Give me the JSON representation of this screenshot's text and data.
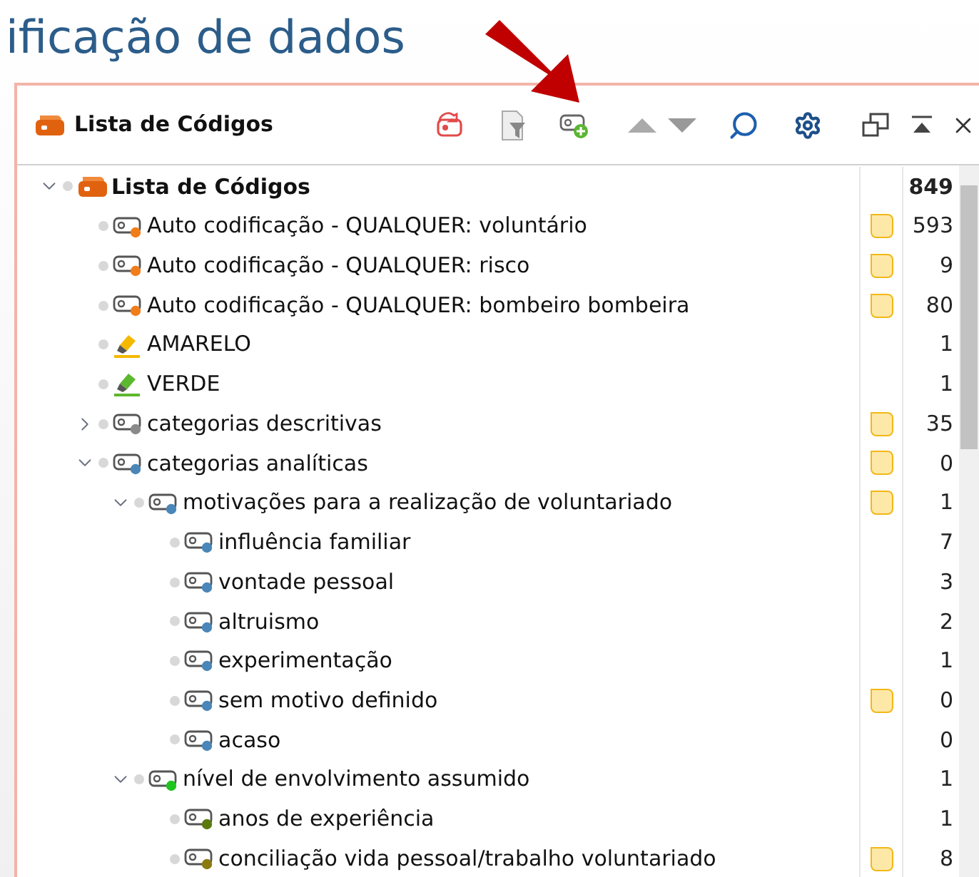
{
  "heading": "ificação de dados",
  "panel": {
    "title": "Lista de Códigos"
  },
  "tree": [
    {
      "label": "Lista de Códigos",
      "kind": "root",
      "expanded": true,
      "memo": false,
      "count": "849",
      "children": [
        {
          "label": "Auto codificação - QUALQUER: voluntário",
          "kind": "code",
          "color": "#f07d1a",
          "memo": true,
          "count": "593"
        },
        {
          "label": "Auto codificação - QUALQUER: risco",
          "kind": "code",
          "color": "#f07d1a",
          "memo": true,
          "count": "9"
        },
        {
          "label": "Auto codificação - QUALQUER: bombeiro bombeira",
          "kind": "code",
          "color": "#f07d1a",
          "memo": true,
          "count": "80"
        },
        {
          "label": "AMARELO",
          "kind": "highlight",
          "color": "#f5b800",
          "memo": false,
          "count": "1"
        },
        {
          "label": "VERDE",
          "kind": "highlight",
          "color": "#5cb82e",
          "memo": false,
          "count": "1"
        },
        {
          "label": "categorias descritivas",
          "kind": "code",
          "color": "#8a8a8a",
          "expanded": false,
          "memo": true,
          "count": "35"
        },
        {
          "label": "categorias analíticas",
          "kind": "code",
          "color": "#4a86b8",
          "expanded": true,
          "memo": true,
          "count": "0",
          "children": [
            {
              "label": "motivações para a realização de voluntariado",
              "kind": "code",
              "color": "#4a86b8",
              "expanded": true,
              "memo": true,
              "count": "1",
              "children": [
                {
                  "label": "influência familiar",
                  "kind": "code",
                  "color": "#4a86b8",
                  "memo": false,
                  "count": "7"
                },
                {
                  "label": "vontade pessoal",
                  "kind": "code",
                  "color": "#4a86b8",
                  "memo": false,
                  "count": "3"
                },
                {
                  "label": "altruismo",
                  "kind": "code",
                  "color": "#4a86b8",
                  "memo": false,
                  "count": "2"
                },
                {
                  "label": "experimentação",
                  "kind": "code",
                  "color": "#4a86b8",
                  "memo": false,
                  "count": "1"
                },
                {
                  "label": "sem motivo definido",
                  "kind": "code",
                  "color": "#4a86b8",
                  "memo": true,
                  "count": "0"
                },
                {
                  "label": "acaso",
                  "kind": "code",
                  "color": "#4a86b8",
                  "memo": false,
                  "count": "0"
                }
              ]
            },
            {
              "label": "nível de envolvimento assumido",
              "kind": "code",
              "color": "#1fc41f",
              "expanded": true,
              "memo": false,
              "count": "1",
              "children": [
                {
                  "label": "anos de experiência",
                  "kind": "code",
                  "color": "#5a7a10",
                  "memo": false,
                  "count": "1"
                },
                {
                  "label": "conciliação vida pessoal/trabalho voluntariado",
                  "kind": "code",
                  "color": "#8a7a10",
                  "memo": true,
                  "count": "8"
                }
              ]
            }
          ]
        }
      ]
    }
  ]
}
